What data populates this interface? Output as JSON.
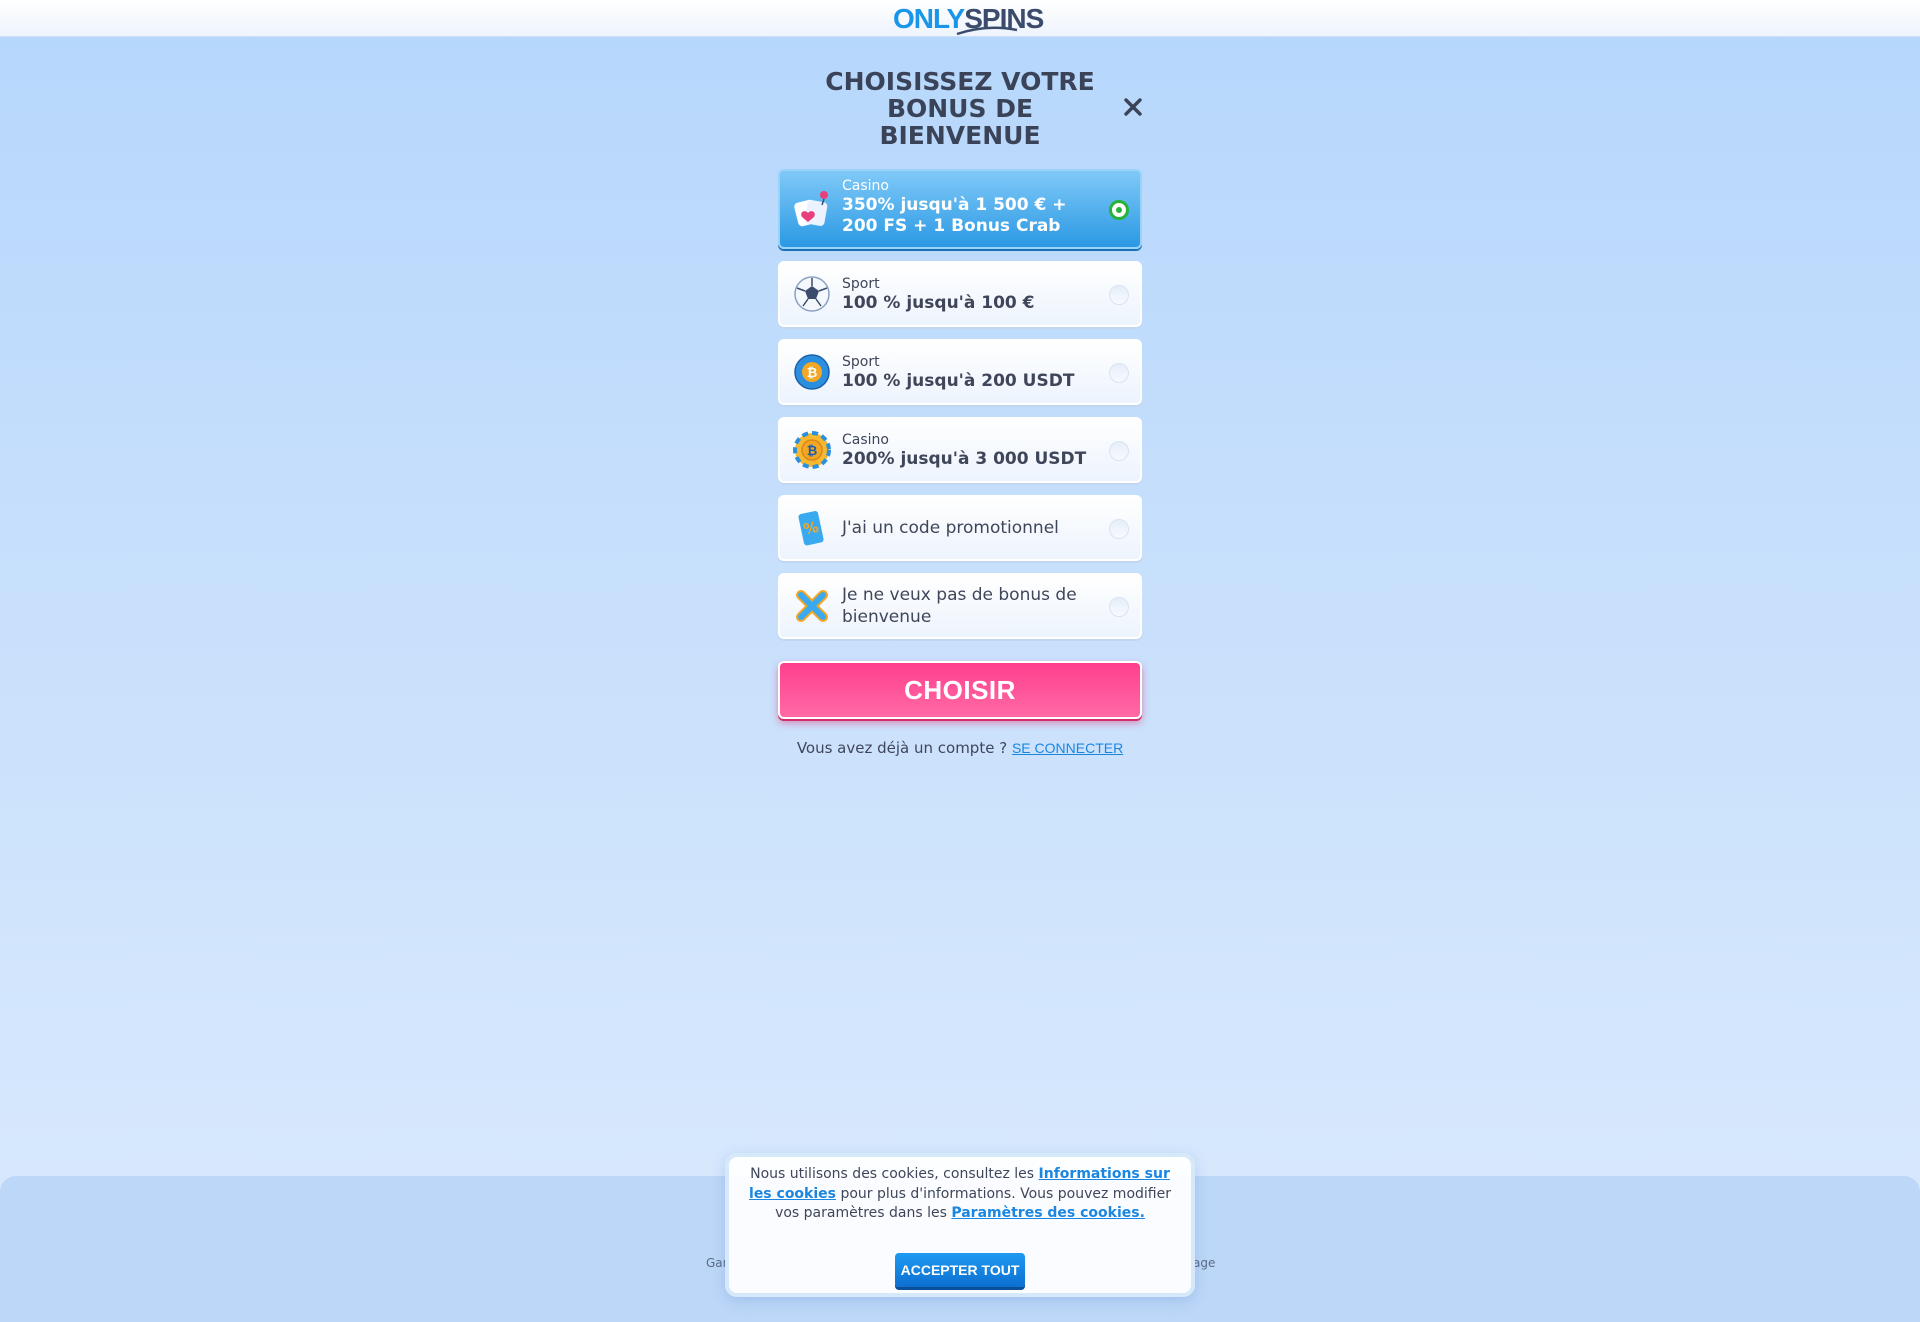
{
  "header": {
    "logo_part1": "ONLY",
    "logo_part2": "SPINS"
  },
  "modal": {
    "title": "CHOISISSEZ VOTRE BONUS DE BIENVENUE",
    "options": [
      {
        "category": "Casino",
        "title": "350% jusqu'à 1 500 € + 200 FS + 1 Bonus Crab",
        "icon": "casino-hearts-icon",
        "selected": true
      },
      {
        "category": "Sport",
        "title": "100 % jusqu'à 100 €",
        "icon": "soccer-ball-icon",
        "selected": false
      },
      {
        "category": "Sport",
        "title": "100 % jusqu'à 200 USDT",
        "icon": "bitcoin-ball-icon",
        "selected": false
      },
      {
        "category": "Casino",
        "title": "200% jusqu'à 3 000 USDT",
        "icon": "bitcoin-chip-icon",
        "selected": false
      },
      {
        "label": "J'ai un code promotionnel",
        "icon": "promo-ticket-icon",
        "selected": false
      },
      {
        "label": "Je ne veux pas de bonus de bienvenue",
        "icon": "no-bonus-x-icon",
        "selected": false
      }
    ],
    "choose_button": "CHOISIR",
    "login_prompt": "Vous avez déjà un compte ?",
    "login_link": "SE CONNECTER"
  },
  "footer": {
    "left_fragment": "Gan",
    "right_fragment": "age"
  },
  "cookie_banner": {
    "text_1": "Nous utilisons des cookies, consultez les",
    "link_1": "Informations sur les cookies",
    "text_2": "pour plus d'informations. Vous pouvez modifier vos paramètres dans les",
    "link_2": "Paramètres des cookies.",
    "accept_button": "ACCEPTER TOUT"
  },
  "colors": {
    "accent_blue": "#1a96e8",
    "cta_pink": "#ff3f8e",
    "radio_green": "#25b33a",
    "text_dark": "#3f465a"
  }
}
